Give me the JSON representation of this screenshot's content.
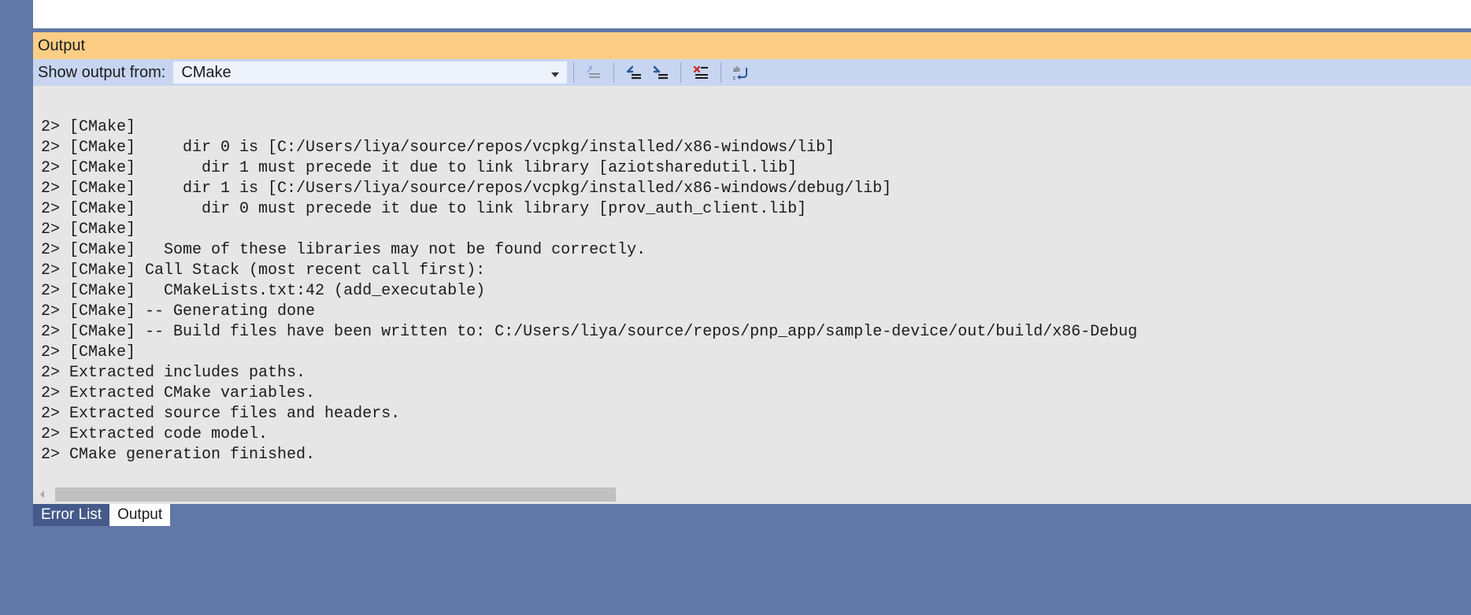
{
  "panel": {
    "title": "Output"
  },
  "toolbar": {
    "show_label": "Show output from:",
    "source_selected": "CMake",
    "icons": {
      "go_to_code": "go-to-code-icon",
      "prev_msg": "previous-message-icon",
      "next_msg": "next-message-icon",
      "clear": "clear-all-icon",
      "wrap": "toggle-word-wrap-icon"
    }
  },
  "log_lines": [
    "2> [CMake] ",
    "2> [CMake]     dir 0 is [C:/Users/liya/source/repos/vcpkg/installed/x86-windows/lib]",
    "2> [CMake]       dir 1 must precede it due to link library [aziotsharedutil.lib]",
    "2> [CMake]     dir 1 is [C:/Users/liya/source/repos/vcpkg/installed/x86-windows/debug/lib]",
    "2> [CMake]       dir 0 must precede it due to link library [prov_auth_client.lib]",
    "2> [CMake] ",
    "2> [CMake]   Some of these libraries may not be found correctly.",
    "2> [CMake] Call Stack (most recent call first):",
    "2> [CMake]   CMakeLists.txt:42 (add_executable)",
    "2> [CMake] -- Generating done",
    "2> [CMake] -- Build files have been written to: C:/Users/liya/source/repos/pnp_app/sample-device/out/build/x86-Debug",
    "2> [CMake] ",
    "2> Extracted includes paths.",
    "2> Extracted CMake variables.",
    "2> Extracted source files and headers.",
    "2> Extracted code model.",
    "2> CMake generation finished."
  ],
  "tabs": {
    "error_list": "Error List",
    "output": "Output"
  }
}
